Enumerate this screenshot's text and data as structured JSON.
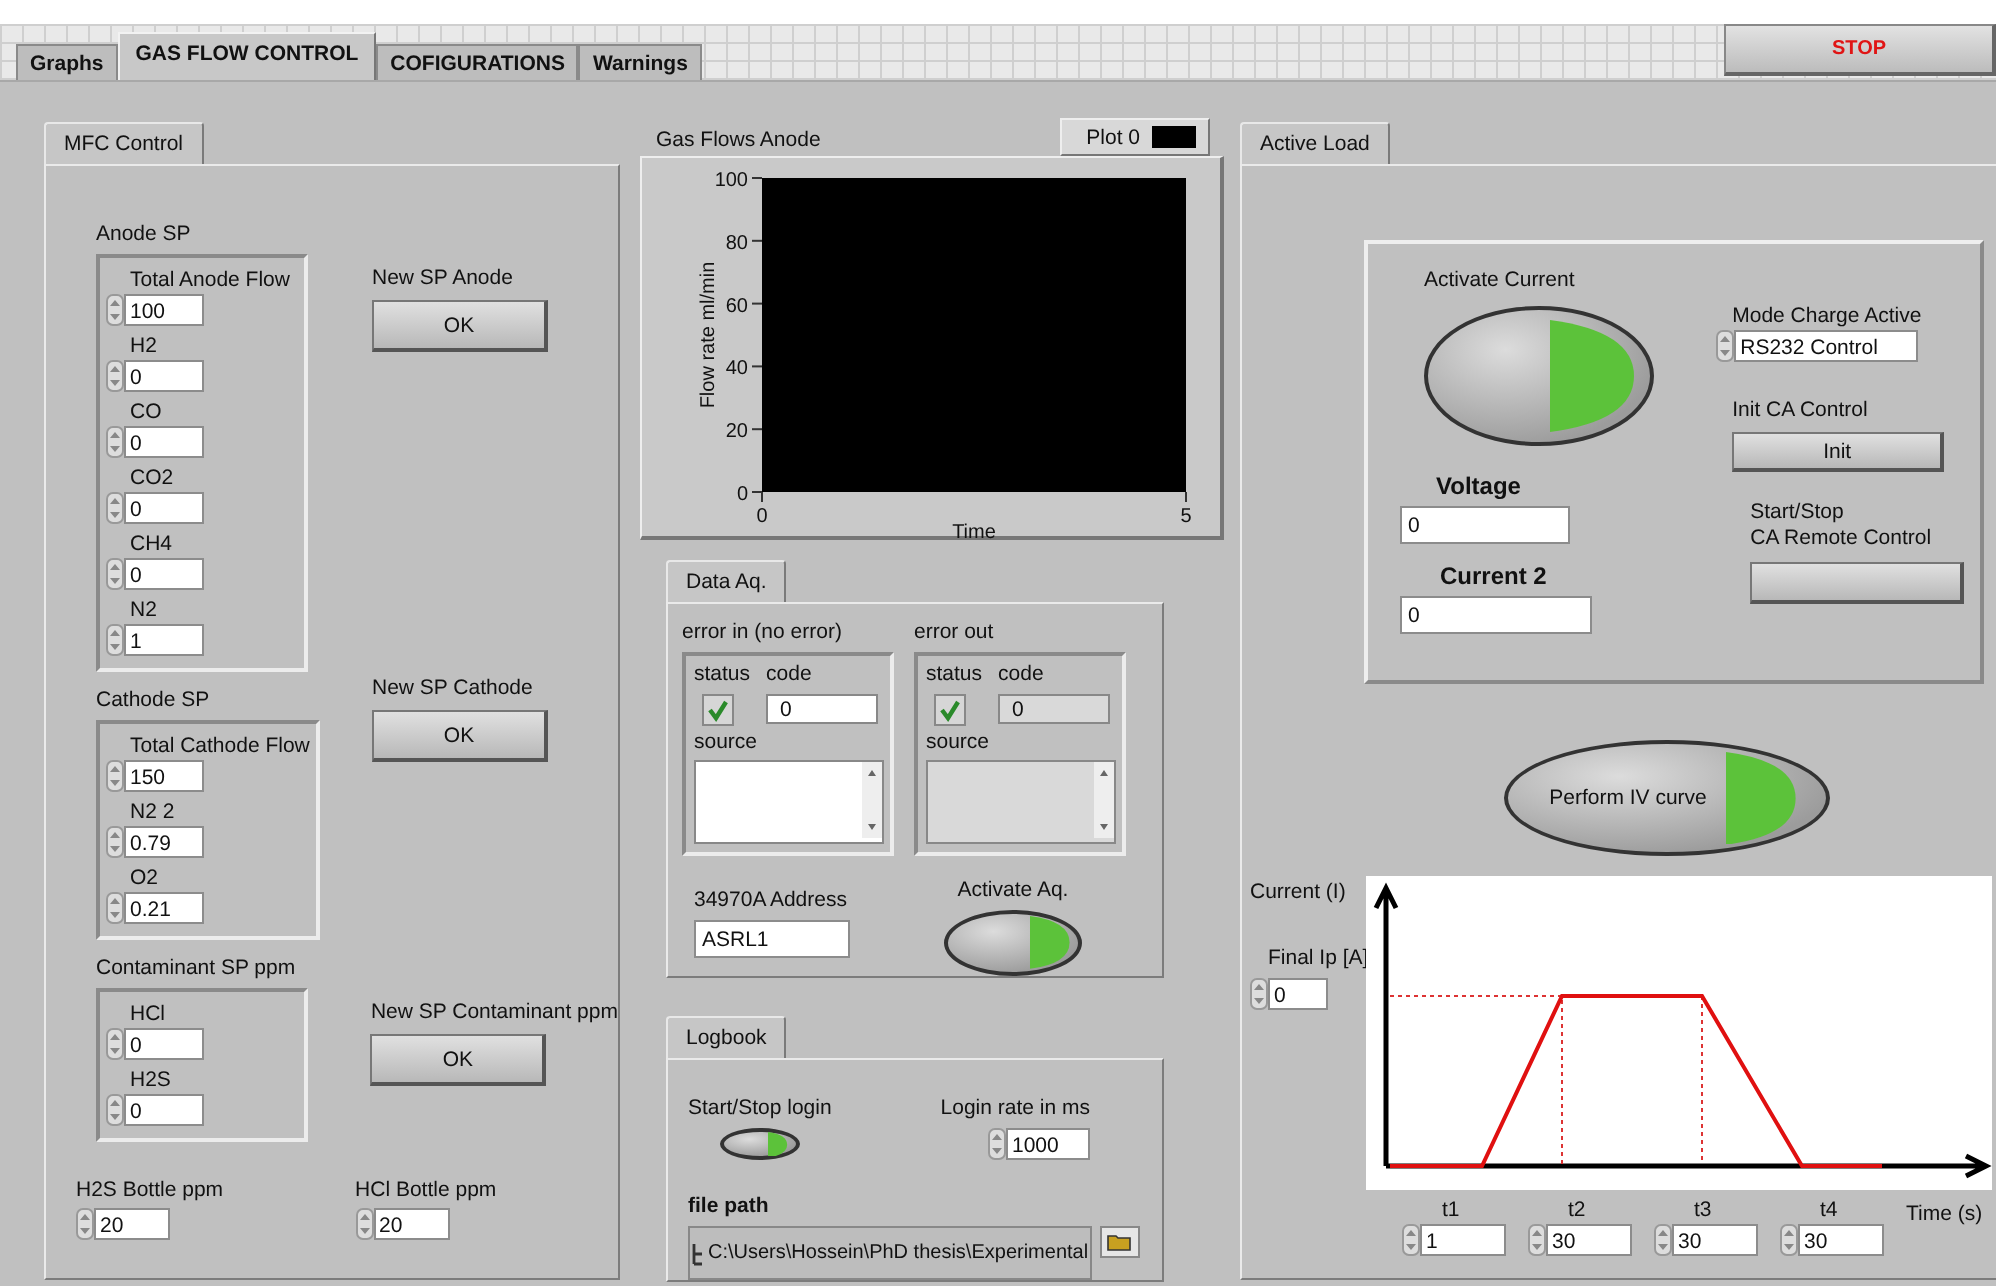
{
  "top_tabs": [
    {
      "label": "Graphs",
      "selected": false
    },
    {
      "label": "GAS FLOW CONTROL",
      "selected": true
    },
    {
      "label": "COFIGURATIONS",
      "selected": false
    },
    {
      "label": "Warnings",
      "selected": false
    }
  ],
  "stop_button": {
    "label": "STOP"
  },
  "mfc_control": {
    "tab": "MFC Control",
    "groups": [
      {
        "title": "Anode SP",
        "fields": [
          {
            "label": "Total Anode Flow",
            "value": "100"
          },
          {
            "label": "H2",
            "value": "0"
          },
          {
            "label": "CO",
            "value": "0"
          },
          {
            "label": "CO2",
            "value": "0"
          },
          {
            "label": "CH4",
            "value": "0"
          },
          {
            "label": "N2",
            "value": "1"
          }
        ],
        "button_caption": "New SP Anode",
        "button": "OK"
      },
      {
        "title": "Cathode SP",
        "fields": [
          {
            "label": "Total Cathode Flow",
            "value": "150"
          },
          {
            "label": "N2 2",
            "value": "0.79"
          },
          {
            "label": "O2",
            "value": "0.21"
          }
        ],
        "button_caption": "New SP Cathode",
        "button": "OK"
      },
      {
        "title": "Contaminant SP ppm",
        "fields": [
          {
            "label": "HCl",
            "value": "0"
          },
          {
            "label": "H2S",
            "value": "0"
          }
        ],
        "button_caption": "New SP Contaminant ppm",
        "button": "OK"
      }
    ],
    "bottles": [
      {
        "label": "H2S Bottle ppm",
        "value": "20"
      },
      {
        "label": "HCl Bottle ppm",
        "value": "20"
      }
    ]
  },
  "graph": {
    "title": "Gas Flows Anode",
    "legend": {
      "label": "Plot 0",
      "color": "#000000"
    },
    "chart_data": {
      "type": "line",
      "xlabel": "Time",
      "ylabel": "Flow rate ml/min",
      "xlim": [
        0,
        5
      ],
      "ylim": [
        0,
        100
      ],
      "xticks": [
        0,
        5
      ],
      "yticks": [
        0,
        20,
        40,
        60,
        80,
        100
      ]
    }
  },
  "data_aq": {
    "tab": "Data Aq.",
    "clusters": [
      {
        "title": "error in (no error)",
        "kind": "control",
        "status_label": "status",
        "status": true,
        "code_label": "code",
        "code": "0",
        "source_label": "source"
      },
      {
        "title": "error out",
        "kind": "indicator",
        "status_label": "status",
        "status": true,
        "code_label": "code",
        "code": "0",
        "source_label": "source"
      }
    ],
    "address": {
      "label": "34970A Address",
      "value": "ASRL1"
    },
    "activate_label": "Activate Aq."
  },
  "logbook": {
    "tab": "Logbook",
    "start_stop_label": "Start/Stop login",
    "rate": {
      "label": "Login rate in ms",
      "value": "1000"
    },
    "file_path": {
      "label": "file path",
      "value": "C:\\Users\\Hossein\\PhD thesis\\Experimental"
    }
  },
  "active_load": {
    "tab": "Active Load",
    "activate_label": "Activate Current",
    "voltage": {
      "label": "Voltage",
      "value": "0"
    },
    "current": {
      "label": "Current 2",
      "value": "0"
    },
    "mode": {
      "label": "Mode Charge Active",
      "value": "RS232 Control"
    },
    "init": {
      "label": "Init CA Control",
      "button": "Init"
    },
    "remote": {
      "label": "Start/Stop\nCA Remote Control"
    },
    "iv_button": "Perform IV curve",
    "profile": {
      "ylabel": "Current (I)",
      "xlabel": "Time (s)",
      "final_ip": {
        "label": "Final Ip [A]",
        "value": "0"
      },
      "times": [
        {
          "label": "t1",
          "value": "1"
        },
        {
          "label": "t2",
          "value": "30"
        },
        {
          "label": "t3",
          "value": "30"
        },
        {
          "label": "t4",
          "value": "30"
        }
      ]
    }
  }
}
